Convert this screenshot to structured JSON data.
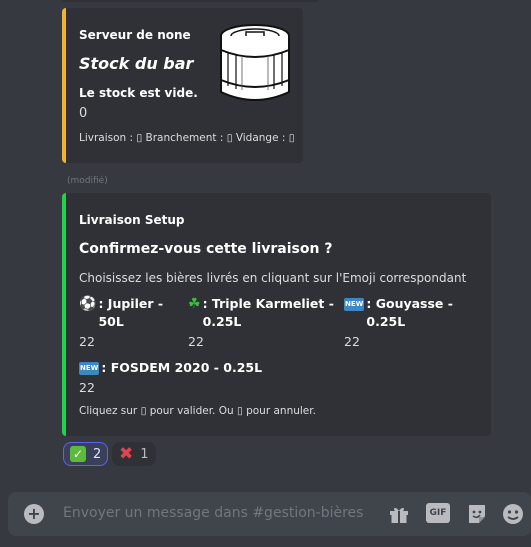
{
  "embed_stock": {
    "author": "Serveur de none",
    "title": "Stock du bar",
    "description": "Le stock est vide.",
    "value": "0",
    "footer": "Livraison : ▯ Branchement : ▯ Vidange : ▯",
    "thumbnail_icon": "beer-keg-image"
  },
  "edited_label": "(modifié)",
  "embed_delivery": {
    "author": "Livraison Setup",
    "title": "Confirmez-vous cette livraison ?",
    "description": "Choisissez les bières livrés en cliquant sur l'Emoji correspondant",
    "fields": [
      {
        "icon": "⚽",
        "name": ": Jupiler - 50L",
        "value": "22"
      },
      {
        "icon": "☘",
        "name": ": Triple Karmeliet - 0.25L",
        "value": "22"
      },
      {
        "icon": "NEW",
        "name": ": Gouyasse - 0.25L",
        "value": "22"
      },
      {
        "icon": "NEW",
        "name": ": FOSDEM 2020 - 0.25L",
        "value": "22"
      }
    ],
    "footer": "Cliquez sur ▯ pour valider. Ou ▯ pour annuler."
  },
  "reactions": [
    {
      "icon": "✓",
      "count": "2",
      "active": true
    },
    {
      "icon": "✖",
      "count": "1",
      "active": false
    }
  ],
  "composer": {
    "placeholder": "Envoyer un message dans #gestion-bières",
    "gif_label": "GIF"
  },
  "colors": {
    "stock_accent": "#f0b232",
    "delivery_accent": "#1fd14d",
    "background": "#36393f",
    "embed_bg": "#2f3136"
  }
}
